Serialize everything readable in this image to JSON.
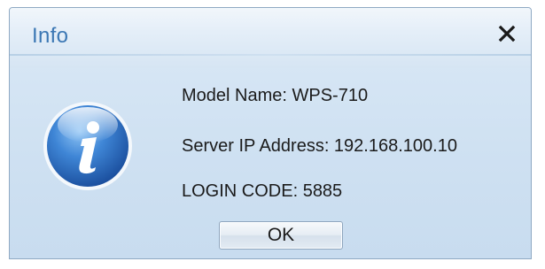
{
  "window": {
    "title": "Info",
    "close_icon": "close-icon"
  },
  "info": {
    "icon": "info-icon",
    "model_name": "Model Name: WPS-710",
    "server_ip": "Server IP Address: 192.168.100.10",
    "login_code": "LOGIN CODE: 5885"
  },
  "buttons": {
    "ok_label": "OK"
  },
  "colors": {
    "title_text": "#3b77b4",
    "dialog_bg": "#cfe1f2",
    "icon_blue": "#2f6fc0"
  }
}
